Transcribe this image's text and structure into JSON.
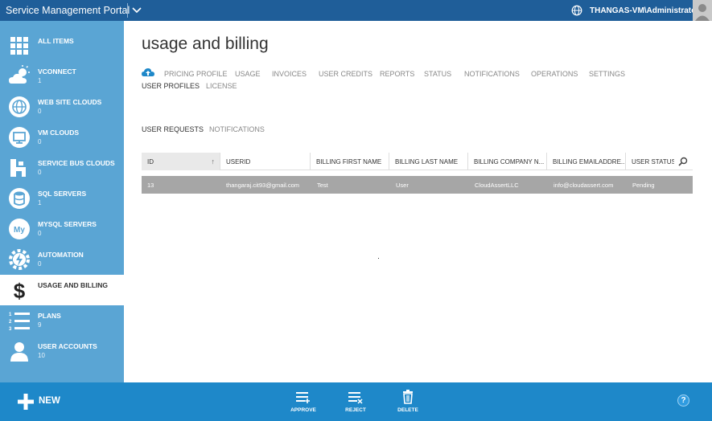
{
  "topbar": {
    "title": "Service Management Portal",
    "user": "THANGAS-VM\\Administrator"
  },
  "sidebar": {
    "items": [
      {
        "label": "ALL ITEMS",
        "count": "",
        "icon": "grid-icon"
      },
      {
        "label": "VCONNECT",
        "count": "1",
        "icon": "cloud-sun-icon"
      },
      {
        "label": "WEB SITE CLOUDS",
        "count": "0",
        "icon": "globe-icon"
      },
      {
        "label": "VM CLOUDS",
        "count": "0",
        "icon": "monitor-icon"
      },
      {
        "label": "SERVICE BUS CLOUDS",
        "count": "0",
        "icon": "service-bus-icon"
      },
      {
        "label": "SQL SERVERS",
        "count": "1",
        "icon": "database-icon"
      },
      {
        "label": "MYSQL SERVERS",
        "count": "0",
        "icon": "mysql-icon"
      },
      {
        "label": "AUTOMATION",
        "count": "0",
        "icon": "gear-lightning-icon"
      },
      {
        "label": "USAGE AND BILLING",
        "count": "",
        "icon": "dollar-icon"
      },
      {
        "label": "PLANS",
        "count": "9",
        "icon": "list-icon"
      },
      {
        "label": "USER ACCOUNTS",
        "count": "10",
        "icon": "user-icon"
      }
    ]
  },
  "main": {
    "title": "usage and billing",
    "tabs": [
      "PRICING PROFILE",
      "USAGE",
      "INVOICES",
      "USER CREDITS",
      "REPORTS",
      "STATUS",
      "NOTIFICATIONS",
      "OPERATIONS",
      "SETTINGS",
      "USER PROFILES",
      "LICENSE"
    ],
    "subtabs": [
      "USER REQUESTS",
      "NOTIFICATIONS"
    ]
  },
  "grid": {
    "columns": [
      "ID",
      "USERID",
      "BILLING FIRST NAME",
      "BILLING LAST NAME",
      "BILLING COMPANY N...",
      "BILLING EMAILADDRE...",
      "USER STATUS"
    ],
    "rows": [
      [
        "13",
        "thangaraj.cit93@gmail.com",
        "Test",
        "User",
        "CloudAssertLLC",
        "info@cloudassert.com",
        "Pending"
      ]
    ]
  },
  "bottombar": {
    "new_label": "NEW",
    "commands": [
      "APPROVE",
      "REJECT",
      "DELETE"
    ],
    "help": "?"
  },
  "colors": {
    "topbar": "#1f5e99",
    "sidebar": "#5aa5d4",
    "bottombar": "#1e88c9",
    "selected_row": "#a6a6a6"
  }
}
